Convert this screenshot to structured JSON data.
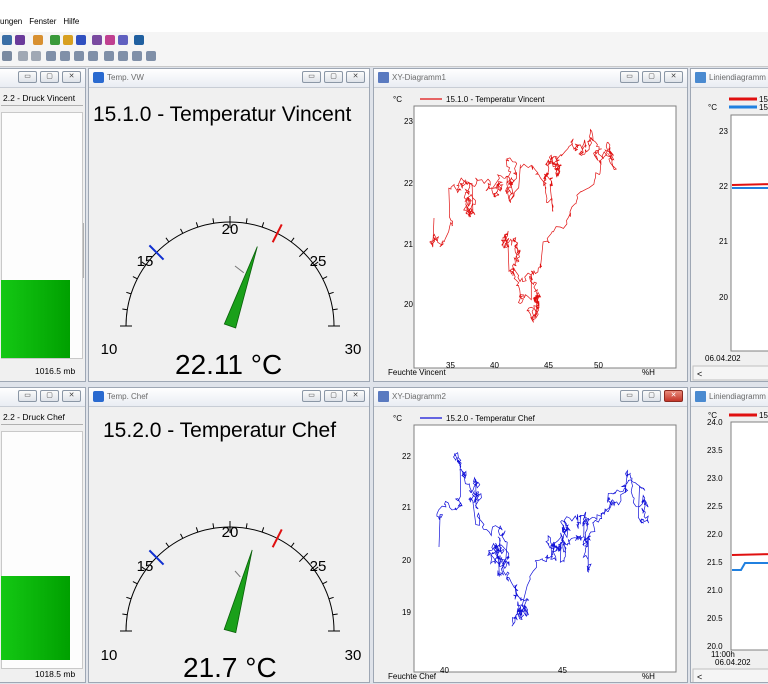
{
  "menu": {
    "items": [
      "ungen",
      "Fenster",
      "Hilfe"
    ]
  },
  "windows": {
    "pressure_top": {
      "label": "2.2 - Druck Vincent",
      "value": "1016.5 mb"
    },
    "pressure_bottom": {
      "label": "2.2 - Druck Chef",
      "value": "1018.5 mb"
    },
    "gauge_top": {
      "title": "Temp. VW",
      "heading": "15.1.0 - Temperatur Vincent",
      "value": "22.11 °C",
      "reading": 22.11,
      "ticks": {
        "t10": "10",
        "t15": "15",
        "t20": "20",
        "t25": "25",
        "t30": "30"
      }
    },
    "gauge_bottom": {
      "title": "Temp. Chef",
      "heading": "15.2.0 - Temperatur Chef",
      "value": "21.7 °C",
      "reading": 21.7,
      "ticks": {
        "t10": "10",
        "t15": "15",
        "t20": "20",
        "t25": "25",
        "t30": "30"
      }
    },
    "xy_top": {
      "title": "XY-Diagramm1",
      "unit": "°C",
      "legend": "15.1.0 - Temperatur Vincent",
      "xlabel": "Feuchte Vincent",
      "xunit": "%H",
      "color": "#e01010",
      "x_ticks": [
        "35",
        "40",
        "45",
        "50"
      ],
      "y_ticks": [
        "23",
        "22",
        "21",
        "20"
      ]
    },
    "xy_bottom": {
      "title": "XY-Diagramm2",
      "unit": "°C",
      "legend": "15.2.0 - Temperatur Chef",
      "xlabel": "Feuchte Chef",
      "xunit": "%H",
      "color": "#1010d8",
      "x_ticks": [
        "40",
        "45"
      ],
      "y_ticks": [
        "22",
        "21",
        "20",
        "19"
      ]
    },
    "line_top": {
      "title": "Liniendiagramm",
      "unit": "°C",
      "legend1": "15",
      "legend2": "15",
      "date": "06.04.202",
      "scroll": "<",
      "y_ticks": [
        "23",
        "22",
        "21",
        "20"
      ]
    },
    "line_bottom": {
      "title": "Liniendiagramm",
      "unit": "°C",
      "legend1": "15",
      "time": "11:00h",
      "date": "06.04.202",
      "scroll": "<",
      "y_ticks": [
        "24.0",
        "23.5",
        "23.0",
        "22.5",
        "22.0",
        "21.5",
        "21.0",
        "20.5",
        "20.0"
      ]
    }
  },
  "colors": {
    "bar_green": "#14c814",
    "red_series": "#e01010",
    "blue_series": "#1010d8",
    "accent": "#3a6ea5"
  }
}
